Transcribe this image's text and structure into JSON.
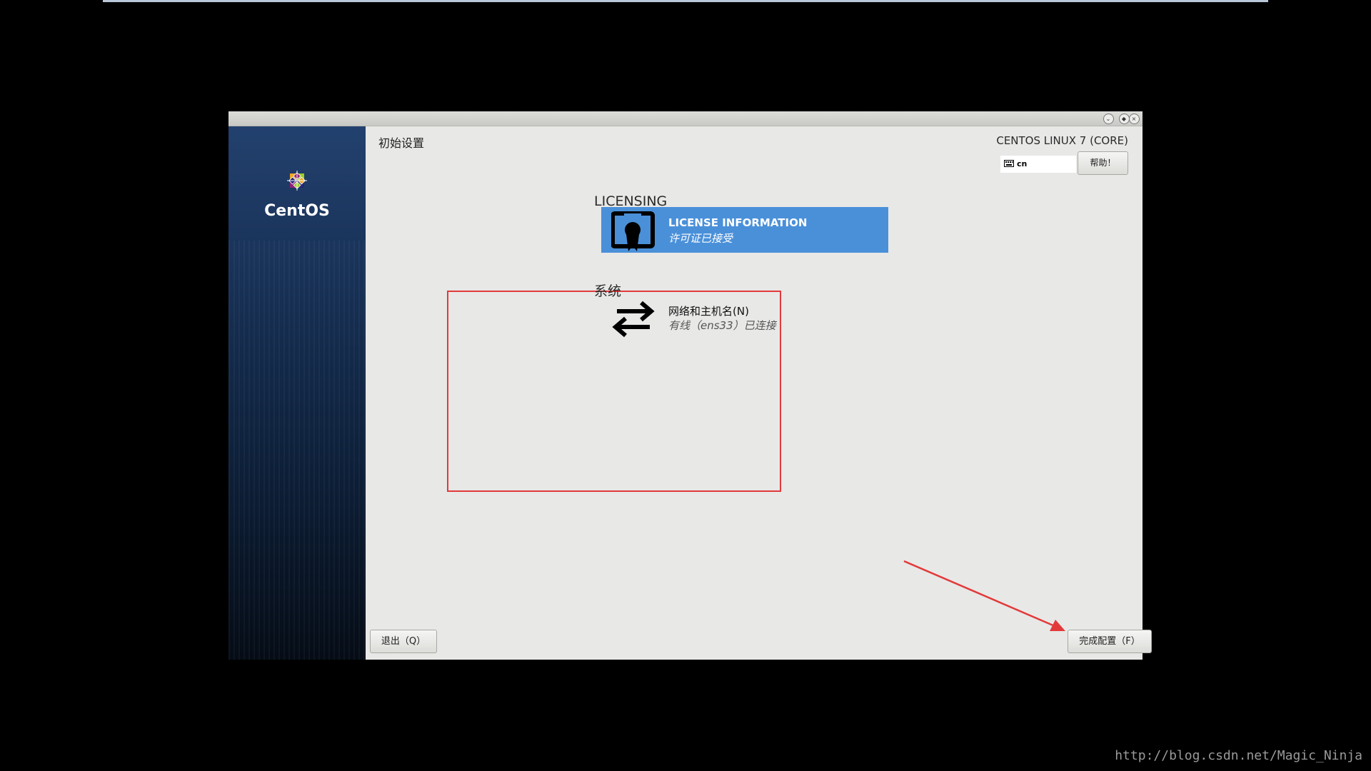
{
  "window": {
    "controls": [
      "minimize",
      "maximize",
      "close"
    ]
  },
  "sidebar": {
    "brand": "CentOS",
    "logo_icon": "centos-logo-icon"
  },
  "header": {
    "title": "初始设置",
    "product": "CENTOS LINUX 7 (CORE)",
    "keyboard_layout": "cn",
    "help_label": "帮助！"
  },
  "sections": [
    {
      "heading": "LICENSING",
      "spokes": [
        {
          "title": "LICENSE INFORMATION",
          "status": "许可证已接受",
          "icon": "license-icon",
          "selected": true
        }
      ]
    },
    {
      "heading": "系统",
      "spokes": [
        {
          "title": "网络和主机名(N)",
          "status": "有线（ens33）已连接",
          "icon": "network-arrows-icon",
          "selected": false
        }
      ]
    }
  ],
  "footer": {
    "quit_label": "退出（Q）",
    "finish_label": "完成配置（F）"
  },
  "annotations": {
    "highlight_color": "#e23a3a",
    "arrow_target": "finish-button"
  },
  "watermark": "http://blog.csdn.net/Magic_Ninja",
  "colors": {
    "accent": "#4a90d9",
    "background": "#e8e8e7",
    "sidebar": "#173055"
  }
}
